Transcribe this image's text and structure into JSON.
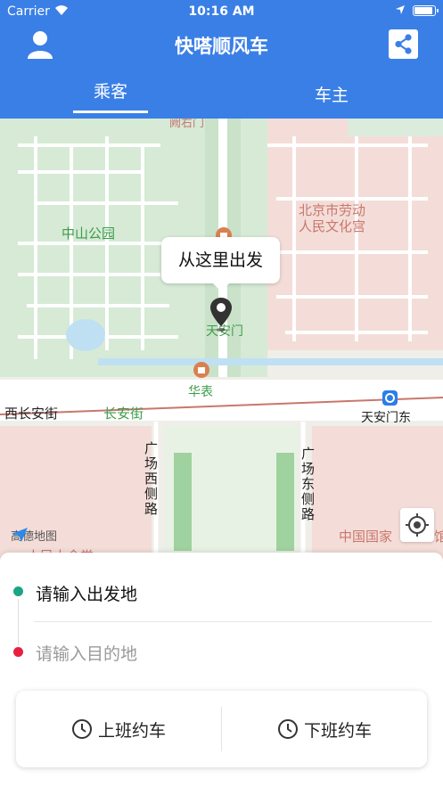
{
  "status_bar": {
    "carrier": "Carrier",
    "time": "10:16 AM"
  },
  "header": {
    "title": "快嗒顺风车",
    "user_icon": "user-icon",
    "share_icon": "share-icon"
  },
  "tabs": [
    {
      "label": "乘客",
      "active": true
    },
    {
      "label": "车主",
      "active": false
    }
  ],
  "map": {
    "labels": {
      "top_partial": "阙右门",
      "zhongshan_park": "中山公园",
      "labor_palace": "北京市劳动\n人民文化宫",
      "tiananmen": "天安门",
      "huabiao": "华表",
      "west_changan": "西长安街",
      "changan": "长安街",
      "tiananmen_east": "天安门东",
      "guangchang_west": "广场西侧路",
      "guangchang_east": "广场东侧路",
      "national_museum": "中国国家",
      "museum_partial": "馆",
      "great_hall_partial": "人民大会堂",
      "amap": "高德地图"
    },
    "callout": "从这里出发",
    "colors": {
      "park_green": "#d6ead6",
      "block_red": "#f4ddd8",
      "road": "#ffffff",
      "river": "#bfe0f2"
    }
  },
  "trip": {
    "start_placeholder": "请输入出发地",
    "end_placeholder": "请输入目的地"
  },
  "commute": {
    "to_work": "上班约车",
    "off_work": "下班约车"
  },
  "colors": {
    "accent": "#3a7fe6",
    "start_dot": "#19a586",
    "end_dot": "#e8203f"
  }
}
